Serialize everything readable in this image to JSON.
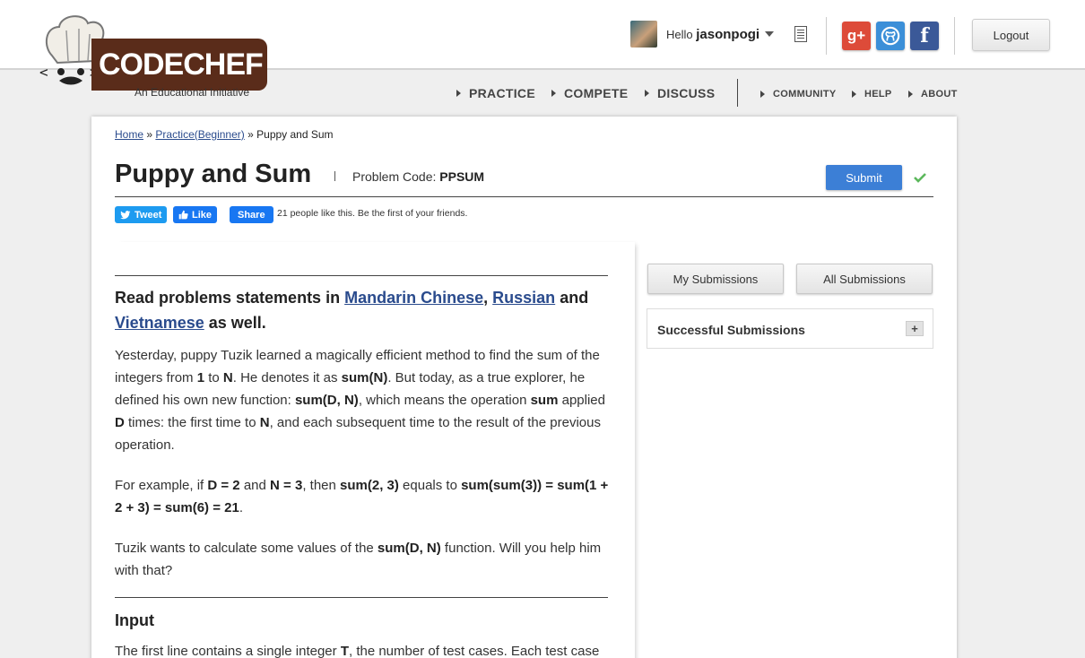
{
  "header": {
    "logo_text": "CODECHEF",
    "tagline": "An Educational Initiative",
    "hello": "Hello",
    "username": "jasonpogi",
    "social": {
      "google": "g+",
      "github": "GH",
      "facebook": "f"
    },
    "logout_label": "Logout",
    "nav_main": [
      "PRACTICE",
      "COMPETE",
      "DISCUSS"
    ],
    "nav_secondary": [
      "COMMUNITY",
      "HELP",
      "ABOUT"
    ]
  },
  "breadcrumb": {
    "home": "Home",
    "sep": "»",
    "practice": "Practice(Beginner)",
    "current": "Puppy and Sum"
  },
  "problem": {
    "title": "Puppy and Sum",
    "code_label": "Problem Code:",
    "code": "PPSUM",
    "submit_label": "Submit"
  },
  "share": {
    "tweet": "Tweet",
    "like": "Like",
    "share": "Share",
    "likes_text": "21 people like this. Be the first of your friends."
  },
  "statement": {
    "lang_prefix": "Read problems statements in",
    "lang1": "Mandarin Chinese",
    "comma": ",",
    "lang2": "Russian",
    "and": "and",
    "lang3": "Vietnamese",
    "lang_suffix": "as well.",
    "input_heading": "Input",
    "input_text_start": "The first line contains a single integer",
    "input_T": "T",
    "input_text_end": ", the number of test cases. Each test case"
  },
  "sidebar": {
    "my_submissions": "My Submissions",
    "all_submissions": "All Submissions",
    "successful": "Successful Submissions",
    "expand": "+"
  },
  "colors": {
    "link": "#2a4b8d",
    "submit": "#3c7fd6",
    "brand": "#5a2c1a",
    "twitter": "#1d9bf0",
    "facebook": "#1877f2",
    "google": "#dd4b39",
    "github": "#3b8fd8",
    "fb_social": "#3b5998"
  }
}
